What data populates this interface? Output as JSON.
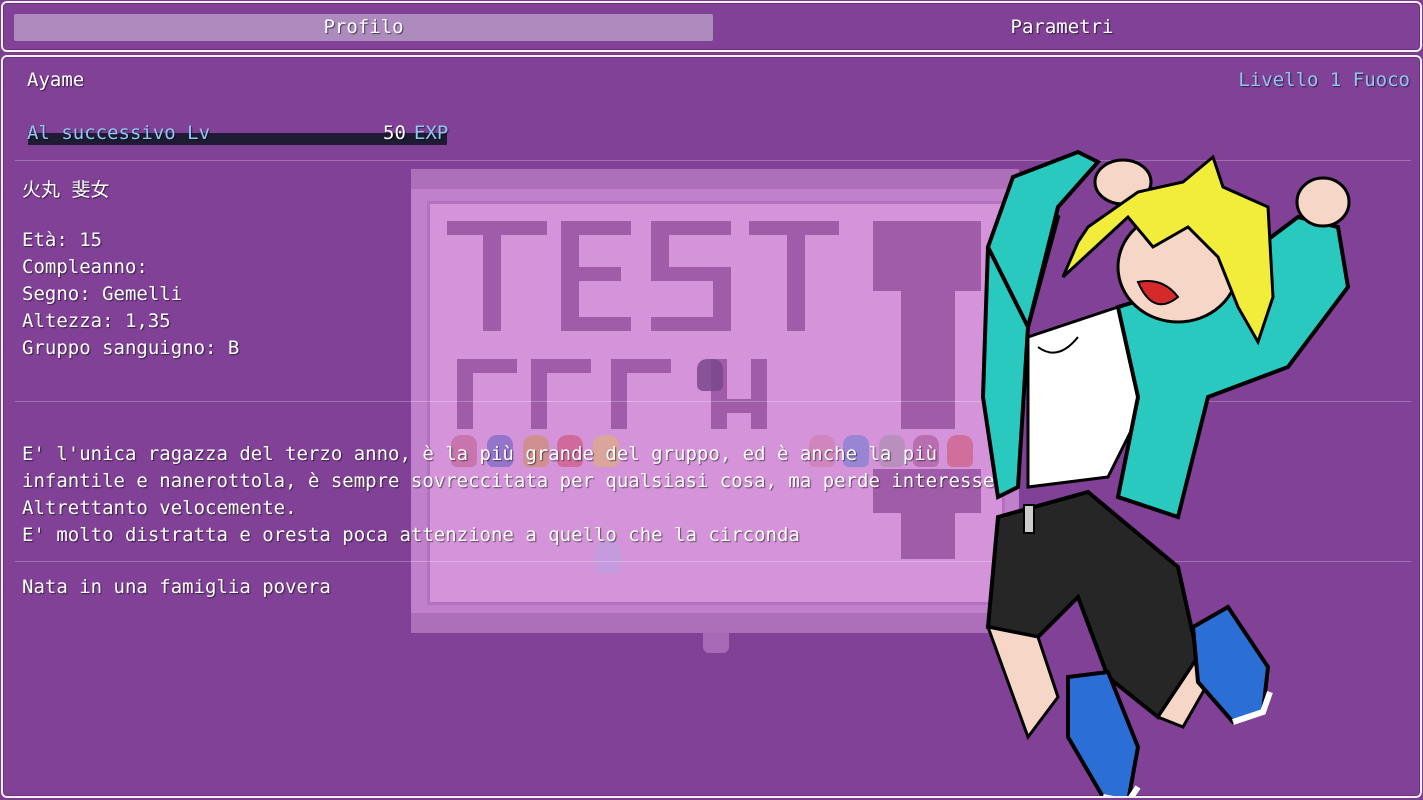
{
  "tabs": [
    {
      "label": "Profilo",
      "selected": true
    },
    {
      "label": "Parametri",
      "selected": false
    }
  ],
  "actor": {
    "name": "Ayame",
    "level_label": "Livello 1 Fuoco"
  },
  "exp": {
    "label": "Al successivo Lv",
    "value": "50",
    "unit": "EXP"
  },
  "profile": {
    "japanese_name": "火丸 斐女",
    "age": "Età: 15",
    "birthday": "Compleanno:",
    "sign": "Segno: Gemelli",
    "height": "Altezza: 1,35",
    "blood": "Gruppo sanguigno: B"
  },
  "bio": {
    "line1": "E' l'unica ragazza del terzo anno, è la più grande del gruppo, ed è anche la più",
    "line2": "infantile e nanerottola, è sempre sovreccitata per qualsiasi cosa, ma perde interesse",
    "line3": "Altrettanto velocemente.",
    "line4": "E' molto distratta e oresta poca attenzione a quello che la circonda",
    "line5": "Nata in una famiglia povera"
  },
  "colors": {
    "background": "#7b3f8e",
    "window": "#8042a0",
    "selected_tab": "#c8bcd8",
    "system_blue": "#8fc7f0",
    "exp_bar": "#1f1b35"
  }
}
